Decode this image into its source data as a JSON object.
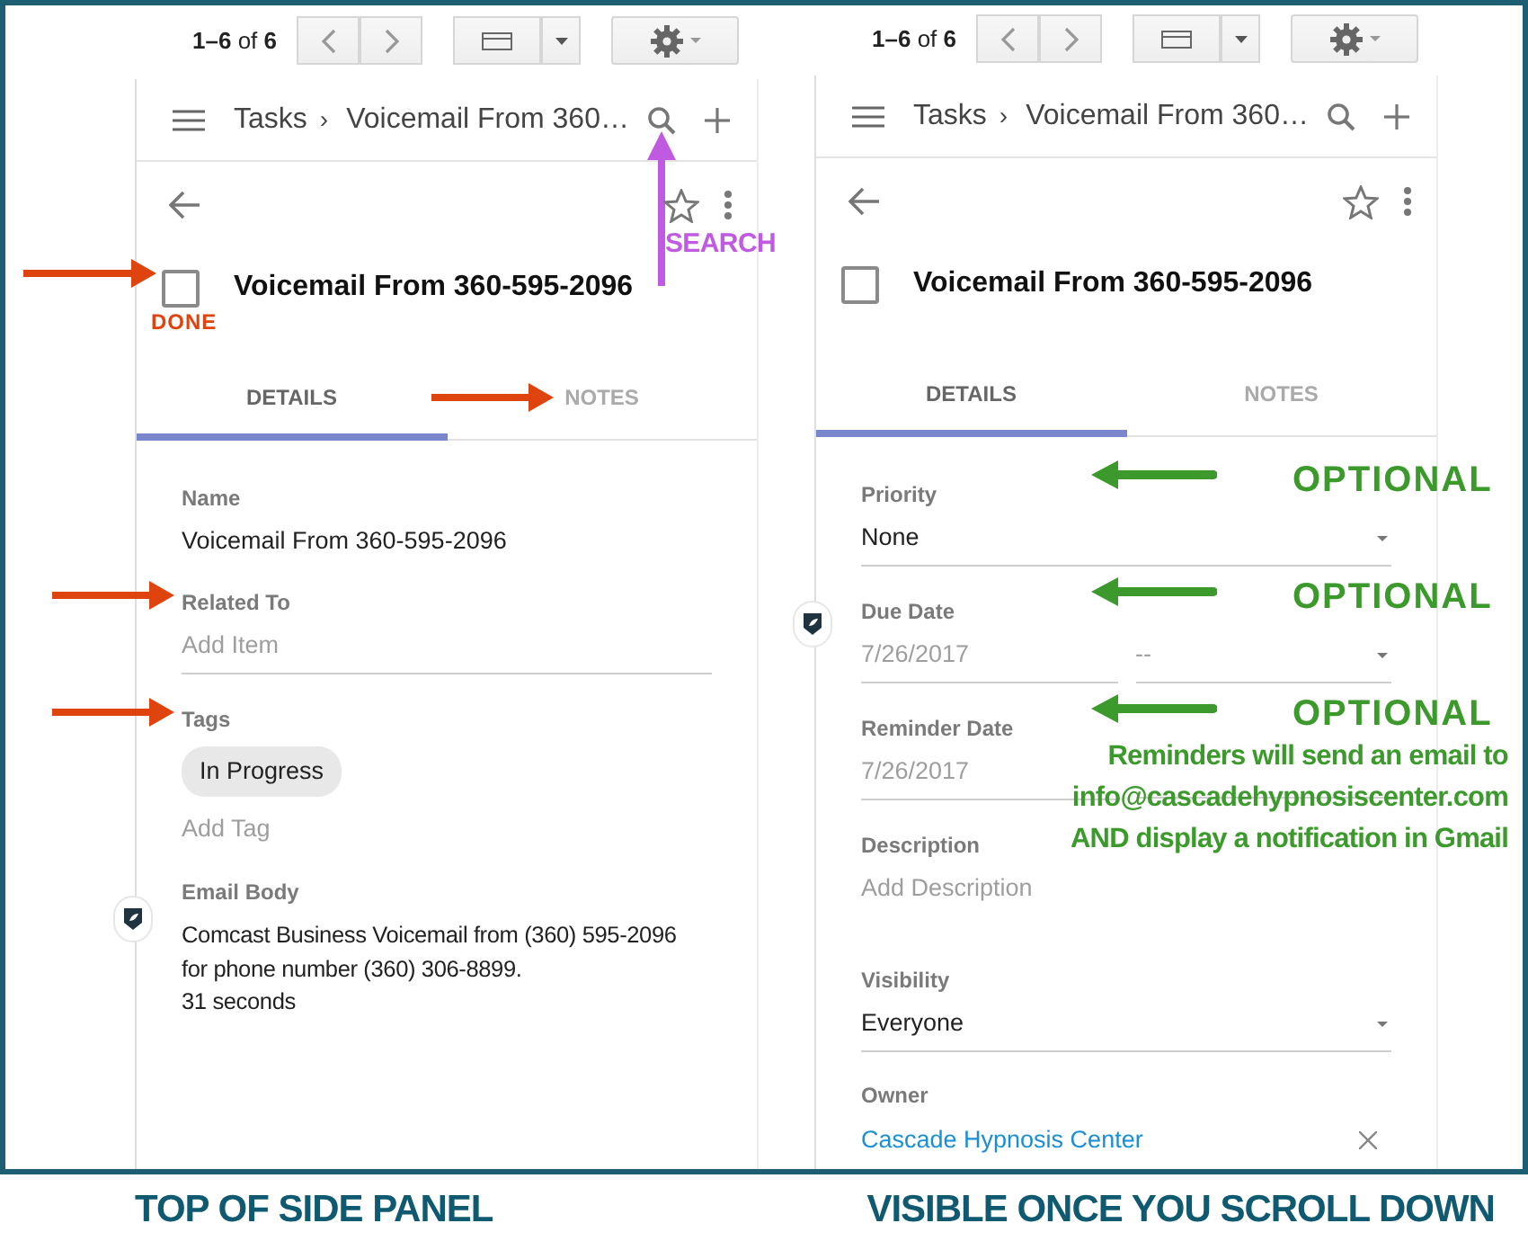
{
  "panels": [
    {
      "caption": "TOP OF SIDE PANEL",
      "toolbar": {
        "range": "**1–6** of **6**"
      },
      "header": {
        "section": "Tasks",
        "separator": "›",
        "title": "Voicemail From 360…",
        "search_annotation": {
          "kind": "arrow-up",
          "text": "SEARCH",
          "color": "#c05ae0"
        }
      },
      "task": {
        "title": "Voicemail From 360-595-2096",
        "checked": false,
        "annotation": {
          "kind": "arrow-label",
          "text": "DONE",
          "color": "#e0440e"
        }
      },
      "tabs": [
        {
          "label": "DETAILS",
          "selected": true
        },
        {
          "label": "NOTES",
          "selected": false,
          "annotation": {
            "kind": "arrow-right",
            "color": "#e0440e"
          }
        }
      ],
      "fields": [
        {
          "kind": "text",
          "label": "Name",
          "value": "Voicemail From 360-595-2096"
        },
        {
          "kind": "input",
          "label": "Related To",
          "placeholder": "Add Item",
          "annotation": {
            "kind": "arrow-right",
            "color": "#e0440e"
          }
        },
        {
          "kind": "tags",
          "label": "Tags",
          "tags": [
            "In Progress"
          ],
          "placeholder": "Add Tag",
          "annotation": {
            "kind": "arrow-right",
            "color": "#e0440e"
          }
        },
        {
          "kind": "multiline",
          "label": "Email Body",
          "value": "Comcast Business Voicemail from (360) 595-2096\nfor phone number (360) 306-8899.\n31 seconds",
          "side_badge": true
        }
      ]
    },
    {
      "caption": "VISIBLE ONCE YOU SCROLL DOWN",
      "toolbar": {
        "range": "**1–6** of **6**"
      },
      "header": {
        "section": "Tasks",
        "separator": "›",
        "title": "Voicemail From 360…"
      },
      "task": {
        "title": "Voicemail From 360-595-2096",
        "checked": false
      },
      "tabs": [
        {
          "label": "DETAILS",
          "selected": true
        },
        {
          "label": "NOTES",
          "selected": false
        }
      ],
      "fields": [
        {
          "kind": "select",
          "label": "Priority",
          "value": "None",
          "annotation": {
            "kind": "arrow-left",
            "text": "OPTIONAL",
            "color": "#3c9a2c"
          }
        },
        {
          "kind": "date_time",
          "label": "Due Date",
          "date": "7/26/2017",
          "time": "--",
          "side_badge": true,
          "annotation": {
            "kind": "arrow-left",
            "text": "OPTIONAL",
            "color": "#3c9a2c"
          }
        },
        {
          "kind": "date_time",
          "label": "Reminder Date",
          "date": "7/26/2017",
          "annotation": {
            "kind": "arrow-left",
            "text": "OPTIONAL",
            "color": "#3c9a2c",
            "note": "Reminders will send an email to\ninfo@cascadehypnosiscenter.com\nAND display a notification in Gmail"
          }
        },
        {
          "kind": "input",
          "label": "Description",
          "placeholder": "Add Description"
        },
        {
          "kind": "select",
          "label": "Visibility",
          "value": "Everyone"
        },
        {
          "kind": "link",
          "label": "Owner",
          "value": "Cascade Hypnosis Center"
        }
      ]
    }
  ]
}
